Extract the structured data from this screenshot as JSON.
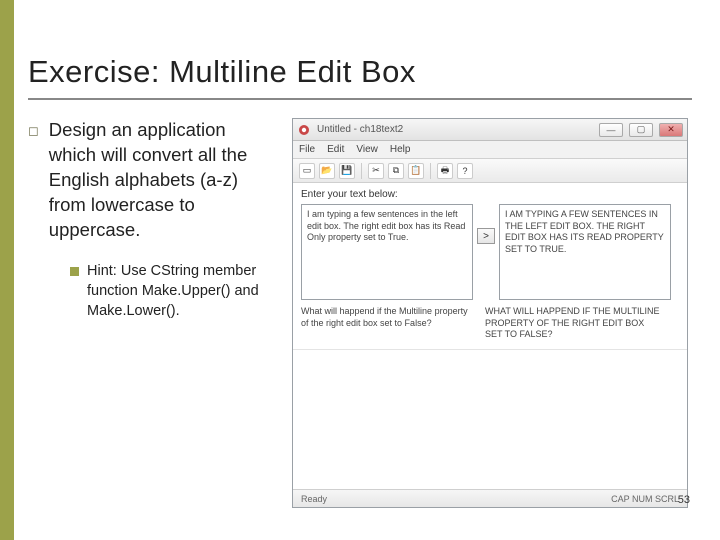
{
  "slide": {
    "title": "Exercise: Multiline Edit Box",
    "bullet": "Design an application which will convert all the English alphabets (a-z) from lowercase to uppercase.",
    "sub_bullet": "Hint: Use CString member function Make.Upper() and Make.Lower().",
    "page_number": "53"
  },
  "app": {
    "title": "Untitled - ch18text2",
    "menus": {
      "file": "File",
      "edit": "Edit",
      "view": "View",
      "help": "Help"
    },
    "toolbar_icons": [
      "new",
      "open",
      "save",
      "cut",
      "copy",
      "paste",
      "print",
      "help"
    ],
    "prompt": "Enter your text below:",
    "left_edit": "I am typing a few sentences in the left edit box.\nThe right edit box has its Read Only property set to True.",
    "right_edit": "I AM TYPING A FEW SENTENCES IN THE LEFT EDIT BOX.\nTHE RIGHT EDIT BOX HAS ITS READ PROPERTY SET TO TRUE.",
    "convert_btn": ">",
    "question_left": "What will happend if the Multiline property of the right edit box set to False?",
    "question_right": "WHAT WILL HAPPEND IF THE MULTILINE PROPERTY OF THE RIGHT EDIT BOX SET TO FALSE?",
    "status_left": "Ready",
    "status_right": "CAP  NUM  SCRL"
  }
}
